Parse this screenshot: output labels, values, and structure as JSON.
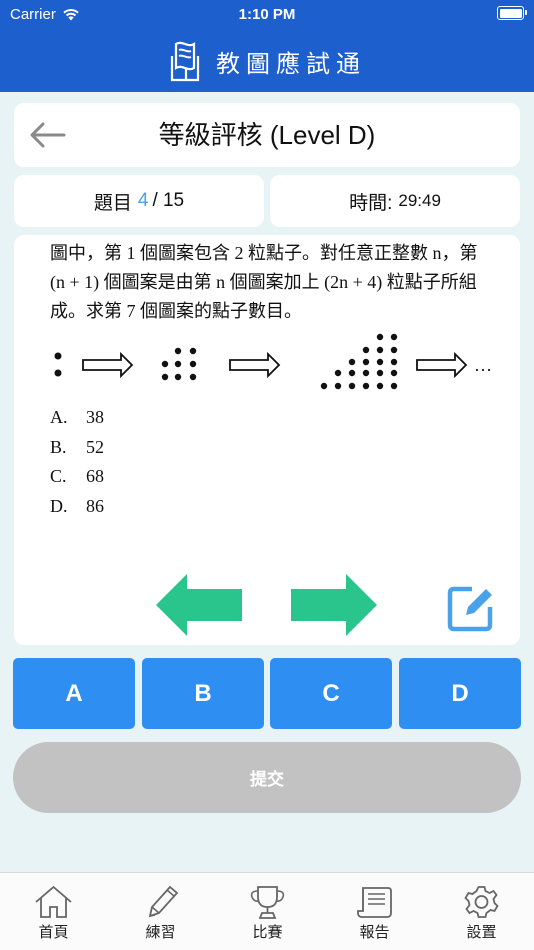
{
  "status_bar": {
    "carrier": "Carrier",
    "time": "1:10 PM"
  },
  "app_title": "教圖應試通",
  "screen_title": "等級評核 (Level D)",
  "counter": {
    "label": "題目",
    "current": "4",
    "total": "/ 15"
  },
  "timer": {
    "label": "時間:",
    "value": "29:49"
  },
  "question": {
    "line1": "圖中，第 1 個圖案包含 2 粒點子。對任意正整數 n，第",
    "line2": "(n + 1) 個圖案是由第 n 個圖案加上 (2n + 4) 粒點子所組",
    "line3": "成。求第 7 個圖案的點子數目。",
    "pattern_ellipsis": "…",
    "options": [
      {
        "key": "A.",
        "value": "38"
      },
      {
        "key": "B.",
        "value": "52"
      },
      {
        "key": "C.",
        "value": "68"
      },
      {
        "key": "D.",
        "value": "86"
      }
    ]
  },
  "answers": [
    "A",
    "B",
    "C",
    "D"
  ],
  "submit_label": "提交",
  "tabs": [
    "首頁",
    "練習",
    "比賽",
    "報告",
    "設置"
  ],
  "colors": {
    "header": "#1e5fce",
    "answer_button": "#2f8ef2",
    "nav_arrow": "#2ac58c",
    "edit_icon": "#4aa3e8",
    "submit_disabled": "#c2c2c2"
  }
}
